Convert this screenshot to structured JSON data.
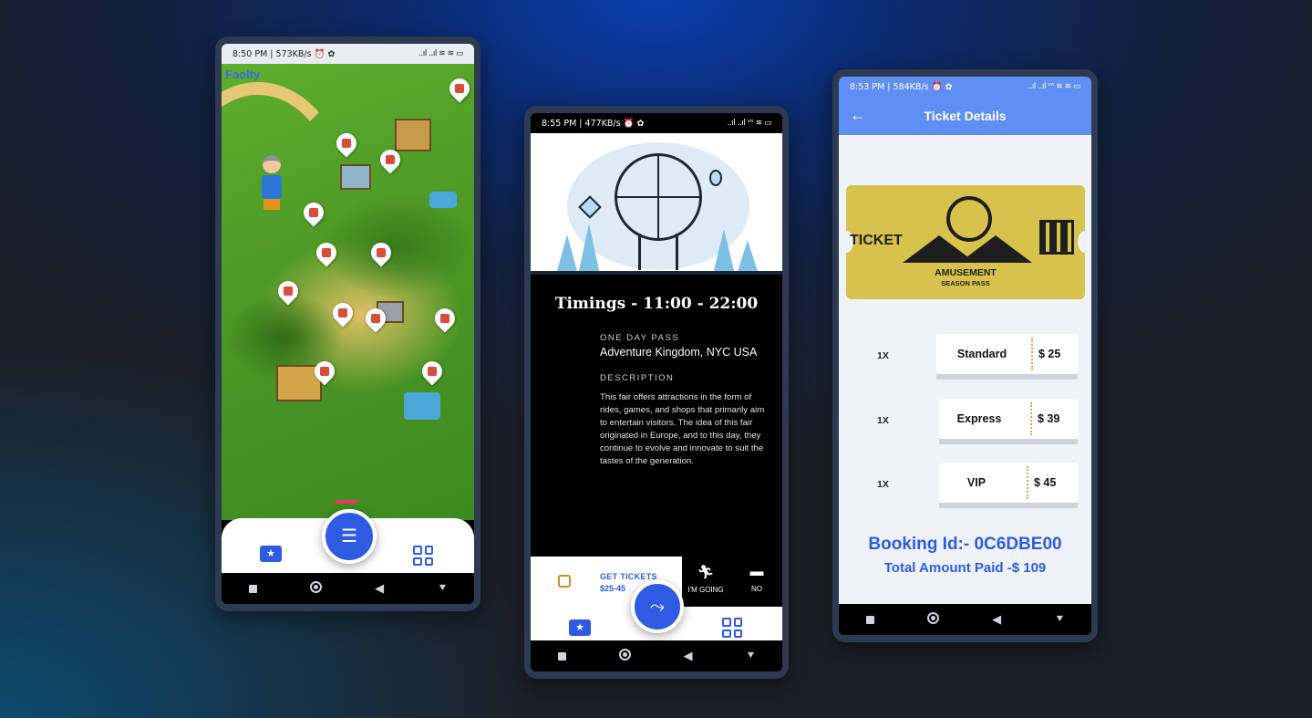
{
  "phone1": {
    "status_time": "8:50 PM | 573KB/s",
    "status_icons": "⏰ ✿",
    "signal": "..ıl ..ıl ≋ ≋ ▭",
    "brand": "Faolty"
  },
  "phone2": {
    "status_time": "8:55 PM | 477KB/s",
    "status_icons": "⏰ ✿",
    "signal": "..ıl ..ıl ᵛᵒ ≋ ▭",
    "timings": "Timings -  11:00 - 22:00",
    "pass_label": "ONE DAY PASS",
    "pass_value": "Adventure Kingdom, NYC USA",
    "desc_label": "DESCRIPTION",
    "description": "This fair offers attractions in the form of rides, games, and shops that primarily aim to entertain visitors. The idea of this fair originated in Europe, and to this day, they continue to evolve and innovate to suit the tastes of the generation.",
    "get_tickets": "GET TICKETS",
    "price_range": "$25-45",
    "going_label": "I'M GOING",
    "no_label": "NO"
  },
  "phone3": {
    "status_time": "8:53 PM | 584KB/s",
    "status_icons": "⏰ ✿",
    "signal": "..ıl ..ıl ᵛᵒ ≋ ≋ ▭",
    "title": "Ticket Details",
    "ticket_word": "TICKET",
    "amusement": "AMUSEMENT",
    "season_pass": "SEASON PASS",
    "tickets": [
      {
        "qty": "1X",
        "name": "Standard",
        "price": "$ 25"
      },
      {
        "qty": "1X",
        "name": "Express",
        "price": "$ 39"
      },
      {
        "qty": "1X",
        "name": "VIP",
        "price": "$ 45"
      }
    ],
    "booking_id": "Booking Id:- 0C6DBE00",
    "total": "Total Amount Paid -$ 109"
  },
  "colors": {
    "accent": "#2f5be3",
    "header": "#5f8ef5",
    "ticket_gold": "#d7c24c"
  }
}
